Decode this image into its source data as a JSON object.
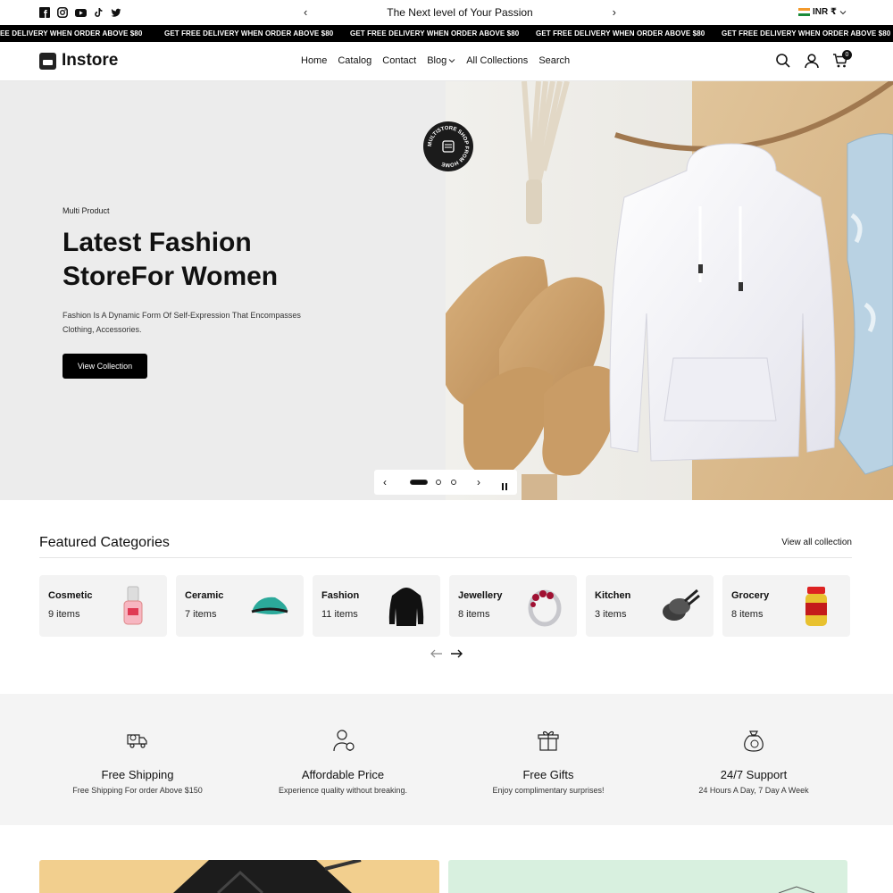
{
  "topbar": {
    "announcement": "The Next level of Your Passion",
    "currency": "INR ₹",
    "socials": [
      "facebook-icon",
      "instagram-icon",
      "youtube-icon",
      "tiktok-icon",
      "twitter-icon"
    ]
  },
  "marquee": {
    "items": [
      "EE DELIVERY WHEN ORDER ABOVE $80",
      "GET FREE DELIVERY WHEN ORDER ABOVE $80",
      "GET FREE DELIVERY WHEN ORDER ABOVE $80",
      "GET FREE DELIVERY WHEN ORDER ABOVE $80",
      "GET FREE DELIVERY WHEN ORDER ABOVE $80"
    ]
  },
  "header": {
    "brand": "Instore",
    "nav": [
      "Home",
      "Catalog",
      "Contact",
      "Blog",
      "All Collections",
      "Search"
    ],
    "cart_count": "0"
  },
  "hero": {
    "eyebrow": "Multi Product",
    "title_line1": "Latest Fashion",
    "title_line2": "StoreFor Women",
    "description": "Fashion Is A Dynamic Form Of Self-Expression That Encompasses Clothing, Accessories.",
    "cta": "View Collection",
    "badge_text": "MULTISTORE SHOP FROM HOME",
    "slide_index": 1,
    "slide_total": 3
  },
  "featured": {
    "title": "Featured Categories",
    "view_all": "View all collection",
    "categories": [
      {
        "name": "Cosmetic",
        "count": "9 items"
      },
      {
        "name": "Ceramic",
        "count": "7 items"
      },
      {
        "name": "Fashion",
        "count": "11 items"
      },
      {
        "name": "Jewellery",
        "count": "8 items"
      },
      {
        "name": "Kitchen",
        "count": "3 items"
      },
      {
        "name": "Grocery",
        "count": "8 items"
      }
    ]
  },
  "services": [
    {
      "title": "Free Shipping",
      "desc": "Free Shipping For order Above $150",
      "icon": "delivery-truck-icon"
    },
    {
      "title": "Affordable Price",
      "desc": "Experience quality without breaking.",
      "icon": "support-agent-icon"
    },
    {
      "title": "Free Gifts",
      "desc": "Enjoy complimentary surprises!",
      "icon": "gift-icon"
    },
    {
      "title": "24/7 Support",
      "desc": "24 Hours A Day, 7 Day A Week",
      "icon": "money-bag-icon"
    }
  ],
  "colors": {
    "accent": "#000000",
    "hero_bg": "#ececec",
    "services_bg": "#f4f4f4",
    "card_bg": "#f3f3f3"
  }
}
